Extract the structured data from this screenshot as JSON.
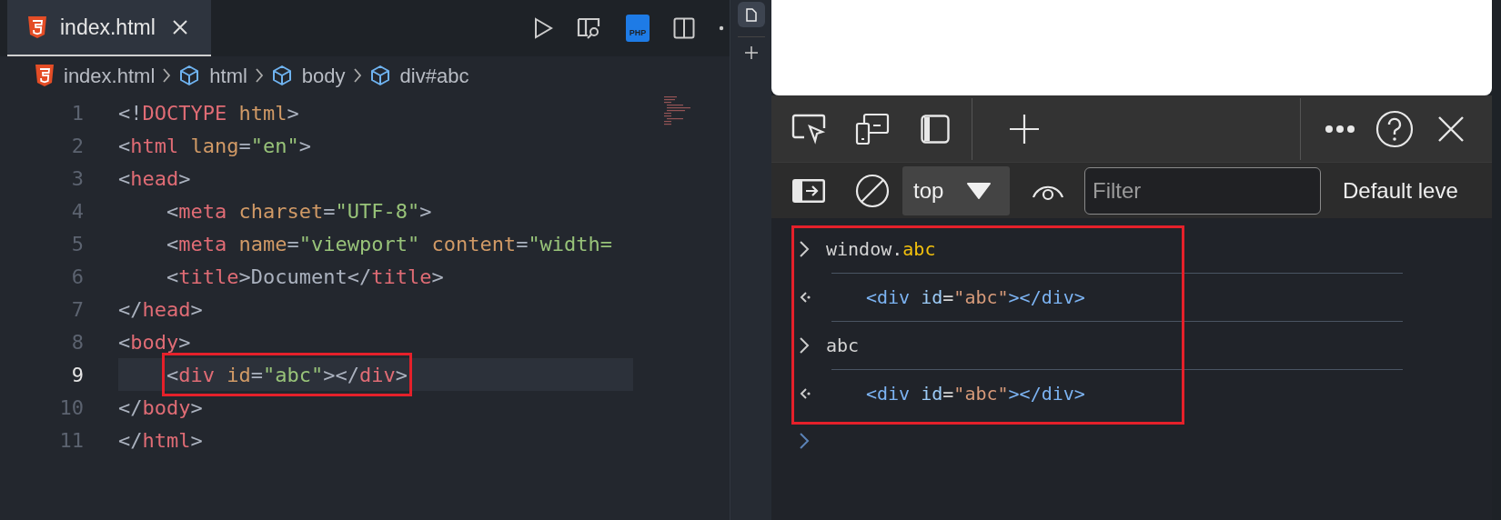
{
  "editor": {
    "tab": {
      "label": "index.html",
      "selected": true
    },
    "php_badge": "PHP",
    "breadcrumbs": [
      {
        "label": "index.html",
        "kind": "file"
      },
      {
        "label": "html",
        "kind": "element"
      },
      {
        "label": "body",
        "kind": "element"
      },
      {
        "label": "div#abc",
        "kind": "element"
      }
    ],
    "lines": [
      {
        "number": "1",
        "current": false,
        "boxed": false,
        "tokens": [
          {
            "kind": "punct",
            "text": "<!"
          },
          {
            "kind": "tag",
            "text": "DOCTYPE"
          },
          {
            "kind": "attr",
            "text": " html"
          },
          {
            "kind": "punct",
            "text": ">"
          }
        ]
      },
      {
        "number": "2",
        "current": false,
        "boxed": false,
        "tokens": [
          {
            "kind": "punct",
            "text": "<"
          },
          {
            "kind": "tag",
            "text": "html"
          },
          {
            "kind": "attr",
            "text": " lang"
          },
          {
            "kind": "punct",
            "text": "="
          },
          {
            "kind": "string",
            "text": "\"en\""
          },
          {
            "kind": "punct",
            "text": ">"
          }
        ]
      },
      {
        "number": "3",
        "current": false,
        "boxed": false,
        "tokens": [
          {
            "kind": "punct",
            "text": "<"
          },
          {
            "kind": "tag",
            "text": "head"
          },
          {
            "kind": "punct",
            "text": ">"
          }
        ]
      },
      {
        "number": "4",
        "current": false,
        "boxed": false,
        "tokens": [
          {
            "kind": "punct",
            "text": "    <"
          },
          {
            "kind": "tag",
            "text": "meta"
          },
          {
            "kind": "attr",
            "text": " charset"
          },
          {
            "kind": "punct",
            "text": "="
          },
          {
            "kind": "string",
            "text": "\"UTF-8\""
          },
          {
            "kind": "punct",
            "text": ">"
          }
        ]
      },
      {
        "number": "5",
        "current": false,
        "boxed": false,
        "tokens": [
          {
            "kind": "punct",
            "text": "    <"
          },
          {
            "kind": "tag",
            "text": "meta"
          },
          {
            "kind": "attr",
            "text": " name"
          },
          {
            "kind": "punct",
            "text": "="
          },
          {
            "kind": "string",
            "text": "\"viewport\""
          },
          {
            "kind": "attr",
            "text": " content"
          },
          {
            "kind": "punct",
            "text": "="
          },
          {
            "kind": "string",
            "text": "\"width="
          }
        ]
      },
      {
        "number": "6",
        "current": false,
        "boxed": false,
        "tokens": [
          {
            "kind": "punct",
            "text": "    <"
          },
          {
            "kind": "tag",
            "text": "title"
          },
          {
            "kind": "punct",
            "text": ">"
          },
          {
            "kind": "text",
            "text": "Document"
          },
          {
            "kind": "punct",
            "text": "</"
          },
          {
            "kind": "tag",
            "text": "title"
          },
          {
            "kind": "punct",
            "text": ">"
          }
        ]
      },
      {
        "number": "7",
        "current": false,
        "boxed": false,
        "tokens": [
          {
            "kind": "punct",
            "text": "</"
          },
          {
            "kind": "tag",
            "text": "head"
          },
          {
            "kind": "punct",
            "text": ">"
          }
        ]
      },
      {
        "number": "8",
        "current": false,
        "boxed": false,
        "tokens": [
          {
            "kind": "punct",
            "text": "<"
          },
          {
            "kind": "tag",
            "text": "body"
          },
          {
            "kind": "punct",
            "text": ">"
          }
        ]
      },
      {
        "number": "9",
        "current": true,
        "boxed": true,
        "tokens": [
          {
            "kind": "punct",
            "text": "    <"
          },
          {
            "kind": "tag",
            "text": "div"
          },
          {
            "kind": "attr",
            "text": " id"
          },
          {
            "kind": "punct",
            "text": "="
          },
          {
            "kind": "string",
            "text": "\"abc\""
          },
          {
            "kind": "punct",
            "text": "></"
          },
          {
            "kind": "tag",
            "text": "div"
          },
          {
            "kind": "punct",
            "text": ">"
          }
        ]
      },
      {
        "number": "10",
        "current": false,
        "boxed": false,
        "tokens": [
          {
            "kind": "punct",
            "text": "</"
          },
          {
            "kind": "tag",
            "text": "body"
          },
          {
            "kind": "punct",
            "text": ">"
          }
        ]
      },
      {
        "number": "11",
        "current": false,
        "boxed": false,
        "tokens": [
          {
            "kind": "punct",
            "text": "</"
          },
          {
            "kind": "tag",
            "text": "html"
          },
          {
            "kind": "punct",
            "text": ">"
          }
        ]
      }
    ]
  },
  "devtools": {
    "context": "top",
    "filter_placeholder": "Filter",
    "levels": "Default leve",
    "console": {
      "boxed": true,
      "entries": [
        {
          "kind": "input",
          "tokens": [
            {
              "kind": "plain",
              "text": "window."
            },
            {
              "kind": "prop",
              "text": "abc"
            }
          ]
        },
        {
          "kind": "output",
          "tokens": [
            {
              "kind": "tag",
              "text": "<div"
            },
            {
              "kind": "attr",
              "text": " id"
            },
            {
              "kind": "plain",
              "text": "="
            },
            {
              "kind": "string",
              "text": "\"abc\""
            },
            {
              "kind": "tag",
              "text": "></div>"
            }
          ]
        },
        {
          "kind": "input",
          "tokens": [
            {
              "kind": "plain",
              "text": "abc"
            }
          ]
        },
        {
          "kind": "output",
          "tokens": [
            {
              "kind": "tag",
              "text": "<div"
            },
            {
              "kind": "attr",
              "text": " id"
            },
            {
              "kind": "plain",
              "text": "="
            },
            {
              "kind": "string",
              "text": "\"abc\""
            },
            {
              "kind": "tag",
              "text": "></div>"
            }
          ]
        }
      ]
    }
  }
}
